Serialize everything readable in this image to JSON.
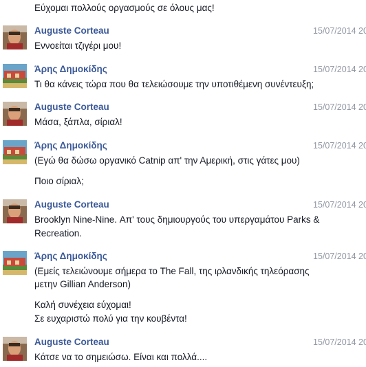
{
  "conversation": {
    "top_message": "Εύχομαι πολλούς οργασμούς σε όλους μας!",
    "messages": [
      {
        "author": "Auguste Corteau",
        "avatar": "avatar-auguste",
        "time": "15/07/2014 20",
        "lines": [
          "Εννοείται τζιγέρι μου!"
        ]
      },
      {
        "author": "Άρης Δημοκίδης",
        "avatar": "avatar-aris",
        "time": "15/07/2014 20",
        "lines": [
          "Τι θα κάνεις τώρα που θα τελειώσουμε την υποτιθέμενη συνέντευξη;"
        ]
      },
      {
        "author": "Auguste Corteau",
        "avatar": "avatar-auguste",
        "time": "15/07/2014 20",
        "lines": [
          "Μάσα, ξάπλα, σίριαλ!"
        ]
      },
      {
        "author": "Άρης Δημοκίδης",
        "avatar": "avatar-aris",
        "time": "15/07/2014 20",
        "lines": [
          "(Εγώ θα δώσω οργανικό Catnip απ' την Αμερική, στις γάτες μου)",
          "",
          "Ποιο σίριαλ;"
        ]
      },
      {
        "author": "Auguste Corteau",
        "avatar": "avatar-auguste",
        "time": "15/07/2014 20",
        "lines": [
          "Brooklyn Nine-Nine. Απ' τους δημιουργούς του υπεργαμάτου Parks &",
          "Recreation."
        ]
      },
      {
        "author": "Άρης Δημοκίδης",
        "avatar": "avatar-aris",
        "time": "15/07/2014 20",
        "lines": [
          "(Εμείς τελειώνουμε σήμερα το The Fall, της ιρλανδικής τηλεόρασης",
          "μετην Gillian Anderson)",
          "",
          "Καλή συνέχεια εύχομαι!",
          "Σε ευχαριστώ πολύ για την κουβέντα!"
        ]
      },
      {
        "author": "Auguste Corteau",
        "avatar": "avatar-auguste",
        "time": "15/07/2014 20",
        "lines": [
          "Κάτσε να το σημειώσω. Είναι και πολλά...."
        ]
      }
    ]
  }
}
